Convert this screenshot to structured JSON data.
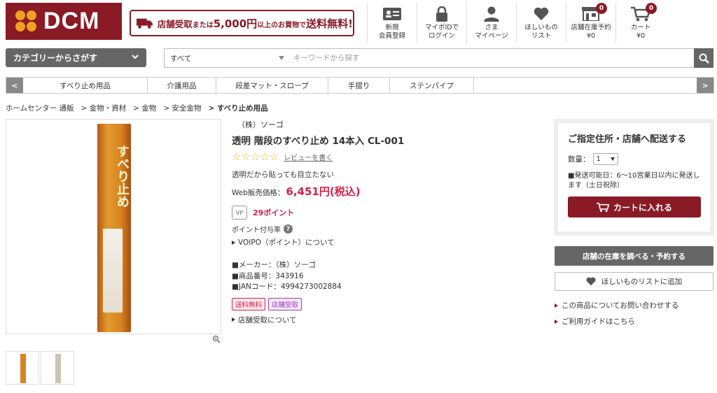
{
  "header": {
    "logo_text": "DCM",
    "promo_lead": "店舗受取",
    "promo_mid": "または",
    "promo_amount": "5,000円",
    "promo_tail": "以上のお買物で",
    "promo_free": "送料無料!",
    "icons": [
      {
        "name": "register",
        "label": "新規\n会員登録",
        "icon": "id-card-icon"
      },
      {
        "name": "login",
        "label": "マイポIDで\nログイン",
        "icon": "lock-icon"
      },
      {
        "name": "mypage",
        "label": "さま\nマイページ",
        "icon": "person-icon"
      },
      {
        "name": "wishlist",
        "label": "ほしいもの\nリスト",
        "icon": "heart-icon"
      },
      {
        "name": "store-reserve",
        "label": "店舗在庫予約\n¥0",
        "icon": "store-icon",
        "badge": "0"
      },
      {
        "name": "cart",
        "label": "カート\n¥0",
        "icon": "cart-icon",
        "badge": "0"
      }
    ]
  },
  "search": {
    "category_button": "カテゴリーからさがす",
    "scope": "すべて",
    "placeholder": "キーワードから探す"
  },
  "catnav": {
    "prev": "<",
    "next": ">",
    "items": [
      "すべり止め用品",
      "介護用品",
      "段差マット・スロープ",
      "手摺り",
      "ステンパイプ"
    ]
  },
  "breadcrumb": [
    "ホームセンター 通販",
    "> 金物・資材",
    "> 金物",
    "> 安全金物",
    "> すべり止め用品"
  ],
  "product": {
    "maker": "（株）ソーゴ",
    "title": "透明 階段のすべり止め 14本入  CL-001",
    "stars": "☆☆☆☆☆",
    "review_link": "レビューを書く",
    "description": "透明だから貼っても目立たない",
    "price_label": "Web販売価格：",
    "price": "6,451円(税込)",
    "vp_label": "VP",
    "points": "29ポイント",
    "point_rate_label": "ポイント付与率",
    "voipo_link": "VOIPO（ポイント）について",
    "spec_maker": "■メーカー：（株）ソーゴ",
    "spec_number": "■商品番号：343916",
    "spec_jan": "■JANコード：4994273002884",
    "tag_free": "送料無料",
    "tag_store": "店舗受取",
    "store_pickup_link": "店舗受取について",
    "box_title": "すべり止め"
  },
  "delivery": {
    "heading": "ご指定住所・店舗へ配送する",
    "qty_label": "数量：",
    "qty_value": "1",
    "ship_info": "■発送可能日：6～10営業日以内に発送します（土日祝除）",
    "cart_button": "カートに入れる"
  },
  "sidebar": {
    "store_button": "店舗の在庫を調べる・予約する",
    "wish_button": "ほしいものリストに追加",
    "inquiry_link": "この商品についてお問い合わせする",
    "guide_link": "ご利用ガイドはこちら"
  },
  "colors": {
    "brand": "#8a1a25",
    "price": "#d6214a",
    "gray_button": "#666666"
  }
}
